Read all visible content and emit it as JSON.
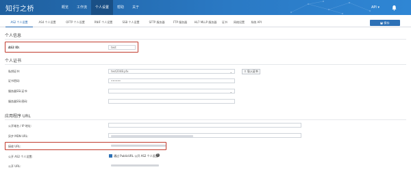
{
  "app": {
    "logo_text": "知行之桥"
  },
  "nav": {
    "items": [
      {
        "label": "概览"
      },
      {
        "label": "工作流"
      },
      {
        "label": "个人设置",
        "active": true
      },
      {
        "label": "帮助"
      },
      {
        "label": "关于"
      }
    ],
    "user_label": "API  ▾"
  },
  "tabs": [
    {
      "label": "AS2 个人设置",
      "active": true
    },
    {
      "label": "AS4 个人设置"
    },
    {
      "label": "OFTP 个人设置"
    },
    {
      "label": "RNIF 个人设置"
    },
    {
      "label": "SSB 个人设置"
    },
    {
      "label": "SFTP 服务器"
    },
    {
      "label": "FTP 服务器"
    },
    {
      "label": "HL7 MLLP 服务器"
    },
    {
      "label": "证书"
    },
    {
      "label": "网络设置"
    },
    {
      "label": "系统 API"
    }
  ],
  "save_button": "保存",
  "sections": {
    "personal_info": "个人信息",
    "personal_cert": "个人证书",
    "app_url": "应用程序 URL"
  },
  "fields": {
    "as2_id": {
      "label": "AS2 ID:",
      "value": "test"
    },
    "private_cert": {
      "label": "私钥证书:",
      "value": "test2048.pfx"
    },
    "cert_password": {
      "label": "证书密码:",
      "value": "••••••"
    },
    "ssl_cert": {
      "label": "服务器SSL证书:",
      "value": ""
    },
    "ssl_password": {
      "label": "服务器SSL密码:",
      "value": ""
    },
    "public_domain": {
      "label": "公开域名 / IP 地址:",
      "value": ""
    },
    "mdn_url": {
      "label": "异步 MDN URL:",
      "value": ""
    },
    "receive_url": {
      "label": "接收 URL:",
      "value": ""
    },
    "public_settings": {
      "label": "公开 AS2 个人设置:",
      "checkbox_label": "通过 PublicURL 公开 AS2 个人设置"
    },
    "public_url": {
      "label": "公开 URL:",
      "value": ""
    }
  },
  "import_button": "导入证书",
  "icons": {
    "bell": "bell-icon",
    "save": "save-icon",
    "upload": "upload-icon",
    "help": "help-icon",
    "dropdown": "chevron-down-icon"
  },
  "colors": {
    "topbar": "#2a79c4",
    "accent": "#2d71b6",
    "highlight": "#c0392b"
  }
}
